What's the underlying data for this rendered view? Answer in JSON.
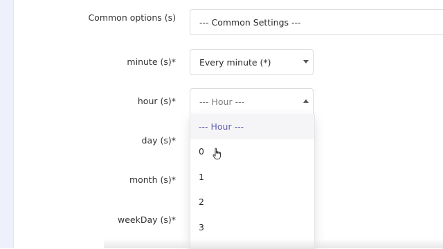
{
  "form": {
    "common": {
      "label": "Common options (s)",
      "value": "--- Common Settings ---"
    },
    "minute": {
      "label": "minute (s)*",
      "value": "Every minute (*)"
    },
    "hour": {
      "label": "hour (s)*",
      "placeholder": "--- Hour ---"
    },
    "day": {
      "label": "day (s)*"
    },
    "month": {
      "label": "month (s)*"
    },
    "weekday": {
      "label": "weekDay (s)*"
    }
  },
  "hour_dropdown": {
    "options": [
      "--- Hour ---",
      "0",
      "1",
      "2",
      "3"
    ],
    "selected_index": 0,
    "hovered_index": 1
  },
  "colors": {
    "selected_option_text": "#5f5fae",
    "sidebar_strip": "#eef0fb"
  },
  "icons": {
    "cursor": "hand-pointer-icon",
    "caret": "caret-down-icon"
  }
}
